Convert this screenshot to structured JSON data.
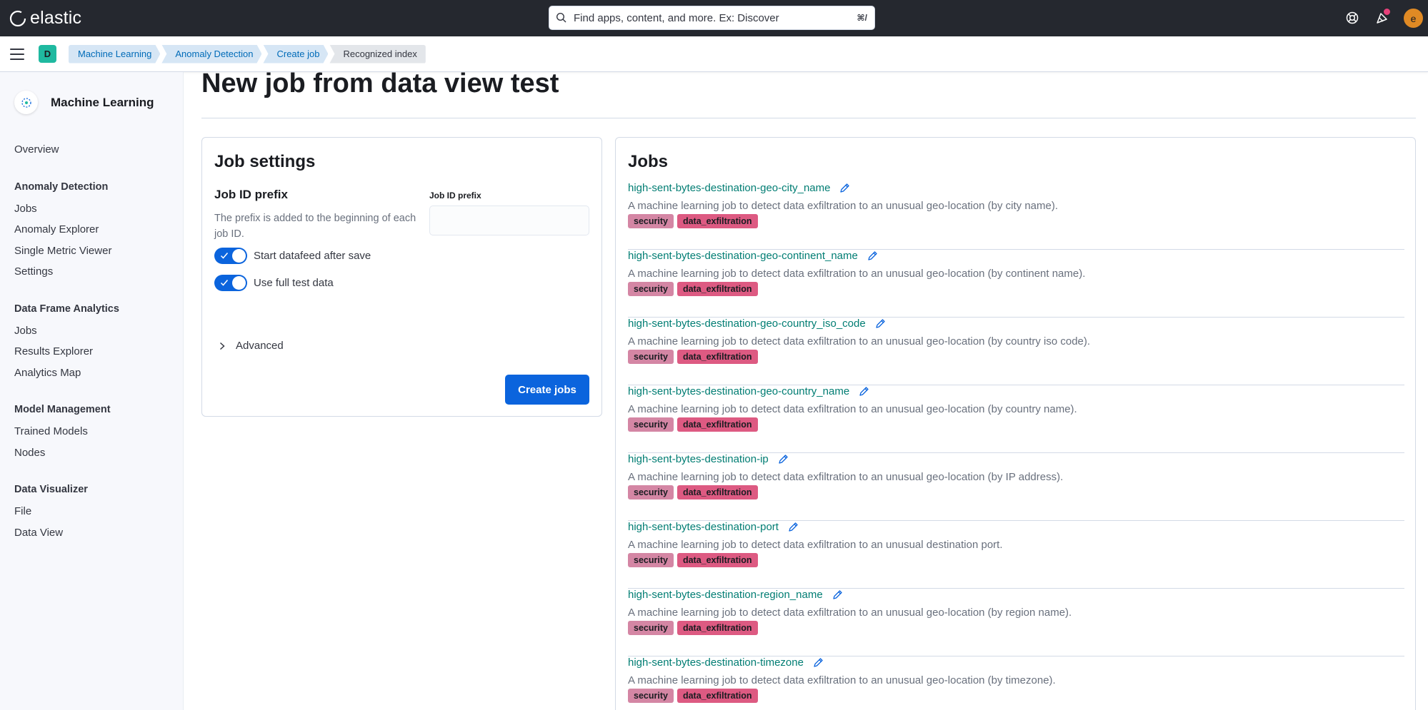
{
  "header": {
    "brand": "elastic",
    "search_placeholder": "Find apps, content, and more. Ex: Discover",
    "search_shortcut": "⌘/",
    "avatar_initial": "e"
  },
  "breadcrumb": {
    "space_initial": "D",
    "items": [
      "Machine Learning",
      "Anomaly Detection",
      "Create job",
      "Recognized index"
    ]
  },
  "sidebar": {
    "title": "Machine Learning",
    "overview": "Overview",
    "groups": [
      {
        "title": "Anomaly Detection",
        "items": [
          "Jobs",
          "Anomaly Explorer",
          "Single Metric Viewer",
          "Settings"
        ]
      },
      {
        "title": "Data Frame Analytics",
        "items": [
          "Jobs",
          "Results Explorer",
          "Analytics Map"
        ]
      },
      {
        "title": "Model Management",
        "items": [
          "Trained Models",
          "Nodes"
        ]
      },
      {
        "title": "Data Visualizer",
        "items": [
          "File",
          "Data View"
        ]
      }
    ]
  },
  "page": {
    "title": "New job from data view test"
  },
  "settings": {
    "title": "Job settings",
    "prefix_title": "Job ID prefix",
    "prefix_desc": "The prefix is added to the beginning of each job ID.",
    "prefix_label": "Job ID prefix",
    "prefix_value": "",
    "switch_datafeed": "Start datafeed after save",
    "switch_full_data": "Use full test data",
    "advanced": "Advanced",
    "create_button": "Create jobs"
  },
  "jobs": {
    "title": "Jobs",
    "items": [
      {
        "name": "high-sent-bytes-destination-geo-city_name",
        "desc": "A machine learning job to detect data exfiltration to an unusual geo-location (by city name).",
        "tags": [
          "security",
          "data_exfiltration"
        ]
      },
      {
        "name": "high-sent-bytes-destination-geo-continent_name",
        "desc": "A machine learning job to detect data exfiltration to an unusual geo-location (by continent name).",
        "tags": [
          "security",
          "data_exfiltration"
        ]
      },
      {
        "name": "high-sent-bytes-destination-geo-country_iso_code",
        "desc": "A machine learning job to detect data exfiltration to an unusual geo-location (by country iso code).",
        "tags": [
          "security",
          "data_exfiltration"
        ]
      },
      {
        "name": "high-sent-bytes-destination-geo-country_name",
        "desc": "A machine learning job to detect data exfiltration to an unusual geo-location (by country name).",
        "tags": [
          "security",
          "data_exfiltration"
        ]
      },
      {
        "name": "high-sent-bytes-destination-ip",
        "desc": "A machine learning job to detect data exfiltration to an unusual geo-location (by IP address).",
        "tags": [
          "security",
          "data_exfiltration"
        ]
      },
      {
        "name": "high-sent-bytes-destination-port",
        "desc": "A machine learning job to detect data exfiltration to an unusual destination port.",
        "tags": [
          "security",
          "data_exfiltration"
        ]
      },
      {
        "name": "high-sent-bytes-destination-region_name",
        "desc": "A machine learning job to detect data exfiltration to an unusual geo-location (by region name).",
        "tags": [
          "security",
          "data_exfiltration"
        ]
      },
      {
        "name": "high-sent-bytes-destination-timezone",
        "desc": "A machine learning job to detect data exfiltration to an unusual geo-location (by timezone).",
        "tags": [
          "security",
          "data_exfiltration"
        ]
      }
    ]
  },
  "colors": {
    "header_bg": "#25282f",
    "primary": "#0b64dd",
    "link": "#017d73",
    "tag_security": "#d486a4",
    "tag_exfiltration": "#dd5a82"
  }
}
